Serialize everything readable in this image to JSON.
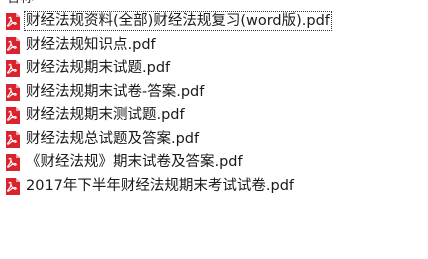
{
  "header": {
    "label": "名称"
  },
  "files": [
    {
      "name": "财经法规资料(全部)财经法规复习(word版).pdf",
      "icon": "pdf-file-icon",
      "selected": true
    },
    {
      "name": "财经法规知识点.pdf",
      "icon": "pdf-file-icon",
      "selected": false
    },
    {
      "name": "财经法规期末试题.pdf",
      "icon": "pdf-file-icon",
      "selected": false
    },
    {
      "name": "财经法规期末试卷-答案.pdf",
      "icon": "pdf-file-icon",
      "selected": false
    },
    {
      "name": "财经法规期末测试题.pdf",
      "icon": "pdf-file-icon",
      "selected": false
    },
    {
      "name": "财经法规总试题及答案.pdf",
      "icon": "pdf-file-icon",
      "selected": false
    },
    {
      "name": "《财经法规》期末试卷及答案.pdf",
      "icon": "pdf-file-icon",
      "selected": false
    },
    {
      "name": "2017年下半年财经法规期末考试试卷.pdf",
      "icon": "pdf-file-icon",
      "selected": false
    }
  ],
  "colors": {
    "pdf_icon_red": "#d9232e",
    "pdf_icon_page": "#ffffff",
    "text": "#1a1a1a"
  }
}
